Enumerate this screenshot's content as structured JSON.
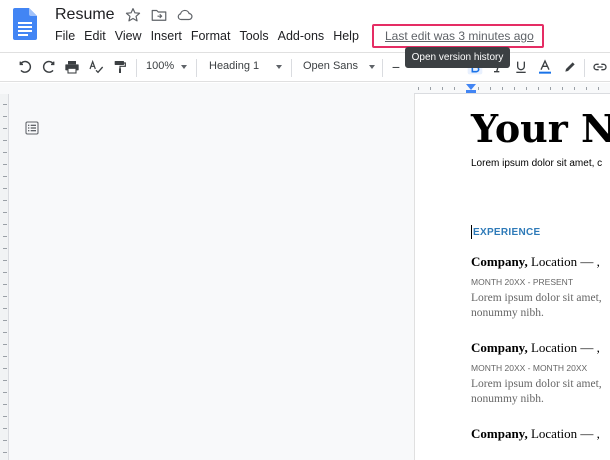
{
  "app": {
    "title": "Resume",
    "accent": "#4285f4"
  },
  "menu": [
    "File",
    "Edit",
    "View",
    "Insert",
    "Format",
    "Tools",
    "Add-ons",
    "Help"
  ],
  "last_edit": {
    "text": "Last edit was 3 minutes ago",
    "highlight_color": "#e52d64"
  },
  "tooltip": {
    "text": "Open version history"
  },
  "toolbar": {
    "zoom": "100%",
    "style": "Heading 1",
    "font": "Open Sans",
    "icons": [
      "undo-icon",
      "redo-icon",
      "print-icon",
      "spellcheck-icon",
      "paint-format-icon",
      "bold-icon",
      "italic-icon",
      "underline-icon",
      "text-color-icon",
      "highlight-icon",
      "link-icon"
    ]
  },
  "document": {
    "name": "Your Na",
    "intro": "Lorem ipsum dolor sit amet, c",
    "section_heading": "EXPERIENCE",
    "section_color": "#2e7ab8",
    "jobs": [
      {
        "company": "Company,",
        "location": " Location — ,",
        "date": "MONTH 20XX - PRESENT",
        "line1": "Lorem ipsum dolor sit amet,",
        "line2": "nonummy nibh."
      },
      {
        "company": "Company,",
        "location": " Location — ,",
        "date": "MONTH 20XX - MONTH 20XX",
        "line1": "Lorem ipsum dolor sit amet,",
        "line2": "nonummy nibh."
      },
      {
        "company": "Company,",
        "location": " Location — ,",
        "date": "",
        "line1": "",
        "line2": ""
      }
    ]
  }
}
